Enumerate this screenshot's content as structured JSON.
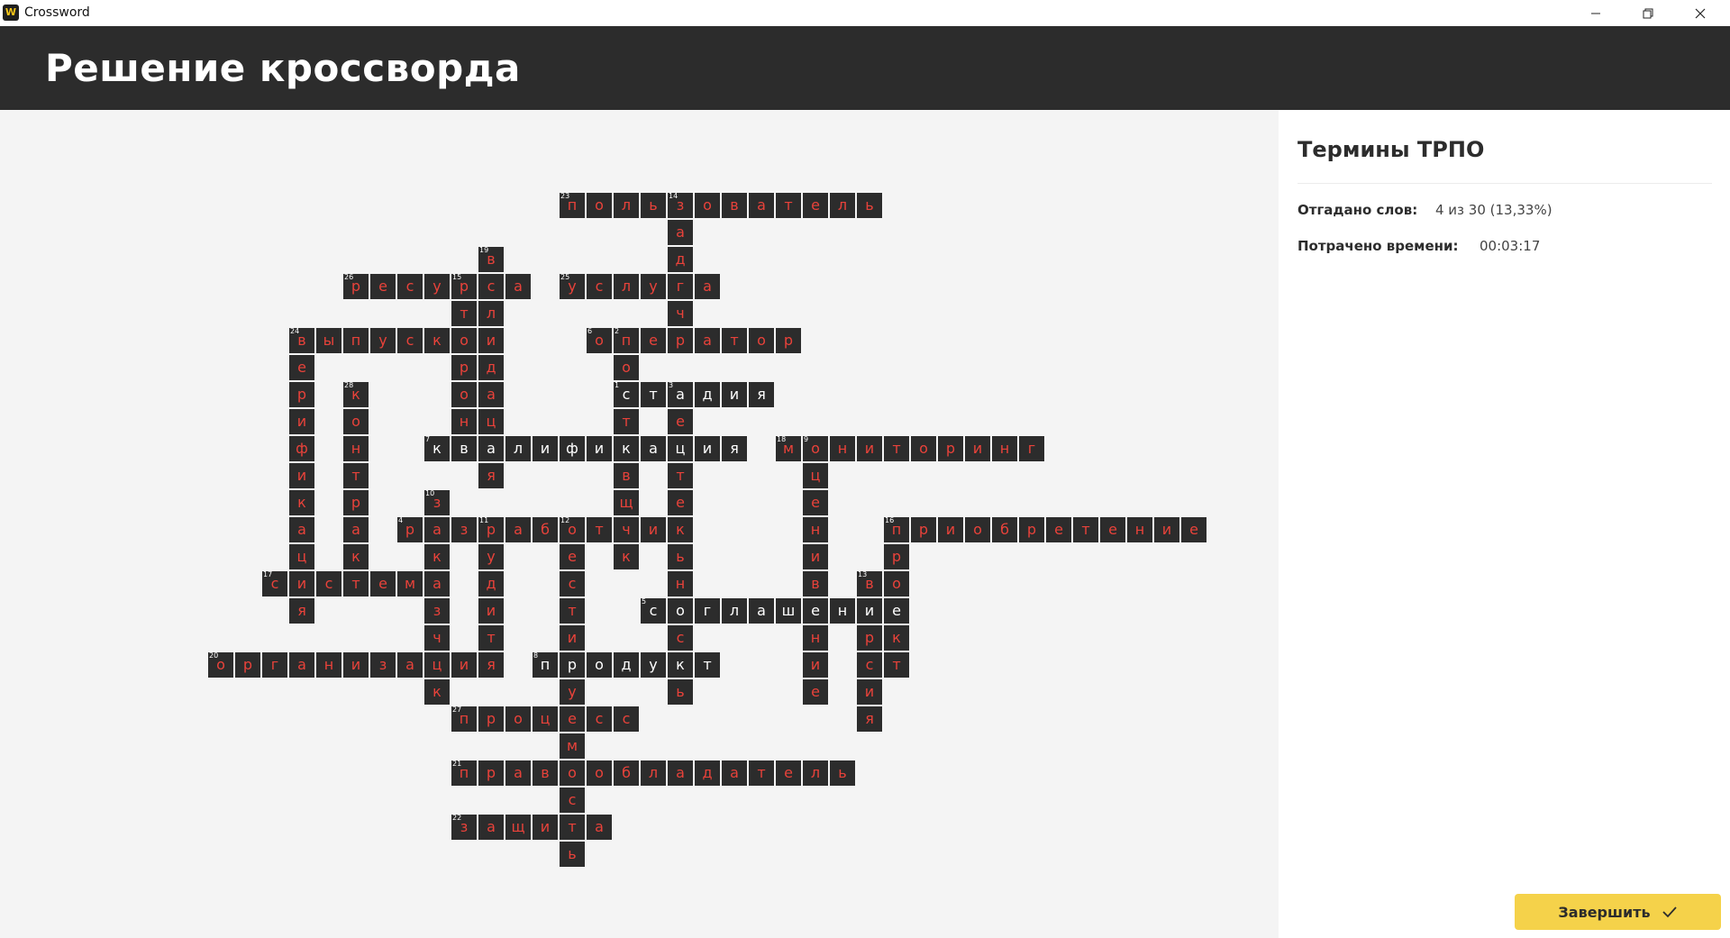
{
  "window": {
    "title": "Crossword",
    "app_icon": "crossword-app-icon"
  },
  "header": {
    "title": "Решение кроссворда"
  },
  "sidebar": {
    "title": "Термины ТРПО",
    "solved_label": "Отгадано слов:",
    "solved_value": "4 из 30 (13,33%)",
    "time_label": "Потрачено времени:",
    "time_value": "00:03:17"
  },
  "finish_button": {
    "label": "Завершить",
    "icon": "check-icon"
  },
  "colors": {
    "header_bg": "#2c2c2c",
    "cell_bg": "#2c2c2c",
    "letter_wrong": "#e8423a",
    "letter_correct": "#ffffff",
    "accent": "#f5d24a"
  },
  "grid": [
    [
      "",
      "",
      "",
      "",
      "",
      "",
      "",
      "",
      "",
      "",
      "",
      "",
      "",
      "",
      "",
      "",
      "",
      "",
      "",
      "",
      "",
      "",
      "",
      "",
      "",
      "",
      "",
      "",
      "",
      "",
      "",
      "",
      "",
      "",
      "",
      "",
      "",
      "",
      "",
      "",
      "",
      ""
    ],
    [
      "",
      "",
      "",
      "",
      "",
      "",
      "",
      "",
      "",
      "",
      "",
      "",
      "",
      "",
      "",
      "",
      "",
      "п",
      "о",
      "л",
      "ь",
      "з",
      "о",
      "в",
      "а",
      "т",
      "е",
      "л",
      "ь",
      "",
      "",
      "",
      "",
      "",
      "",
      "",
      "",
      "",
      "",
      "",
      "",
      ""
    ],
    [
      "",
      "",
      "",
      "",
      "",
      "",
      "",
      "",
      "",
      "",
      "",
      "",
      "",
      "",
      "",
      "",
      "",
      "",
      "",
      "",
      "",
      "а",
      "",
      "",
      "",
      "",
      "",
      "",
      "",
      "",
      "",
      "",
      "",
      "",
      "",
      "",
      "",
      "",
      "",
      "",
      "",
      ""
    ],
    [
      "",
      "",
      "",
      "",
      "",
      "",
      "",
      "",
      "",
      "",
      "",
      "",
      "",
      "",
      "в",
      "",
      "",
      "",
      "",
      "",
      "",
      "д",
      "",
      "",
      "",
      "",
      "",
      "",
      "",
      "",
      "",
      "",
      "",
      "",
      "",
      "",
      "",
      "",
      "",
      "",
      "",
      ""
    ],
    [
      "",
      "",
      "",
      "",
      "",
      "",
      "",
      "",
      "",
      "р",
      "е",
      "с",
      "у",
      "р",
      "с",
      "а",
      "",
      "у",
      "с",
      "л",
      "у",
      "г",
      "а",
      "",
      "",
      "",
      "",
      "",
      "",
      "",
      "",
      "",
      "",
      "",
      "",
      "",
      "",
      "",
      "",
      "",
      "",
      ""
    ],
    [
      "",
      "",
      "",
      "",
      "",
      "",
      "",
      "",
      "",
      "",
      "",
      "",
      "",
      "т",
      "л",
      "",
      "",
      "",
      "",
      "",
      "",
      "ч",
      "",
      "",
      "",
      "",
      "",
      "",
      "",
      "",
      "",
      "",
      "",
      "",
      "",
      "",
      "",
      "",
      "",
      "",
      "",
      ""
    ],
    [
      "",
      "",
      "",
      "",
      "",
      "",
      "",
      "в",
      "ы",
      "п",
      "у",
      "с",
      "к",
      "о",
      "и",
      "",
      "",
      "",
      "о",
      "п",
      "е",
      "р",
      "а",
      "т",
      "о",
      "р",
      "",
      "",
      "",
      "",
      "",
      "",
      "",
      "",
      "",
      "",
      "",
      "",
      "",
      "",
      "",
      ""
    ],
    [
      "",
      "",
      "",
      "",
      "",
      "",
      "",
      "е",
      "",
      "",
      "",
      "",
      "",
      "р",
      "д",
      "",
      "",
      "",
      "",
      "о",
      "",
      "",
      "",
      "",
      "",
      "",
      "",
      "",
      "",
      "",
      "",
      "",
      "",
      "",
      "",
      "",
      "",
      "",
      "",
      "",
      "",
      ""
    ],
    [
      "",
      "",
      "",
      "",
      "",
      "",
      "",
      "р",
      "",
      "к",
      "",
      "",
      "",
      "о",
      "а",
      "",
      "",
      "",
      "",
      "с",
      "т",
      "а",
      "д",
      "и",
      "я",
      "",
      "",
      "",
      "",
      "",
      "",
      "",
      "",
      "",
      "",
      "",
      "",
      "",
      "",
      "",
      "",
      ""
    ],
    [
      "",
      "",
      "",
      "",
      "",
      "",
      "",
      "и",
      "",
      "о",
      "",
      "",
      "",
      "н",
      "ц",
      "",
      "",
      "",
      "",
      "т",
      "",
      "е",
      "",
      "",
      "",
      "",
      "",
      "",
      "",
      "",
      "",
      "",
      "",
      "",
      "",
      "",
      "",
      "",
      "",
      "",
      "",
      ""
    ],
    [
      "",
      "",
      "",
      "",
      "",
      "",
      "",
      "ф",
      "",
      "н",
      "",
      "",
      "к",
      "в",
      "а",
      "л",
      "и",
      "ф",
      "и",
      "к",
      "а",
      "ц",
      "и",
      "я",
      "",
      "м",
      "о",
      "н",
      "и",
      "т",
      "о",
      "р",
      "и",
      "н",
      "г",
      "",
      "",
      "",
      "",
      "",
      "",
      ""
    ],
    [
      "",
      "",
      "",
      "",
      "",
      "",
      "",
      "и",
      "",
      "т",
      "",
      "",
      "",
      "",
      "я",
      "",
      "",
      "",
      "",
      "в",
      "",
      "т",
      "",
      "",
      "",
      "",
      "ц",
      "",
      "",
      "",
      "",
      "",
      "",
      "",
      "",
      "",
      "",
      "",
      "",
      "",
      "",
      ""
    ],
    [
      "",
      "",
      "",
      "",
      "",
      "",
      "",
      "к",
      "",
      "р",
      "",
      "",
      "з",
      "",
      "",
      "",
      "",
      "",
      "",
      "щ",
      "",
      "е",
      "",
      "",
      "",
      "",
      "е",
      "",
      "",
      "",
      "",
      "",
      "",
      "",
      "",
      "",
      "",
      "",
      "",
      "",
      "",
      ""
    ],
    [
      "",
      "",
      "",
      "",
      "",
      "",
      "",
      "а",
      "",
      "а",
      "",
      "р",
      "а",
      "з",
      "р",
      "а",
      "б",
      "о",
      "т",
      "ч",
      "и",
      "к",
      "",
      "",
      "",
      "",
      "н",
      "",
      "",
      "п",
      "р",
      "и",
      "о",
      "б",
      "р",
      "е",
      "т",
      "е",
      "н",
      "и",
      "е",
      ""
    ],
    [
      "",
      "",
      "",
      "",
      "",
      "",
      "",
      "ц",
      "",
      "к",
      "",
      "",
      "к",
      "",
      "у",
      "",
      "",
      "е",
      "",
      "к",
      "",
      "ь",
      "",
      "",
      "",
      "",
      "и",
      "",
      "",
      "р",
      "",
      "",
      "",
      "",
      "",
      "",
      "",
      "",
      "",
      "",
      "",
      ""
    ],
    [
      "",
      "",
      "",
      "",
      "",
      "",
      "с",
      "и",
      "с",
      "т",
      "е",
      "м",
      "а",
      "",
      "д",
      "",
      "",
      "с",
      "",
      "",
      "",
      "н",
      "",
      "",
      "",
      "",
      "в",
      "",
      "в",
      "о",
      "",
      "",
      "",
      "",
      "",
      "",
      "",
      "",
      "",
      "",
      "",
      ""
    ],
    [
      "",
      "",
      "",
      "",
      "",
      "",
      "",
      "я",
      "",
      "",
      "",
      "",
      "з",
      "",
      "и",
      "",
      "",
      "т",
      "",
      "",
      "с",
      "о",
      "г",
      "л",
      "а",
      "ш",
      "е",
      "н",
      "и",
      "е",
      "",
      "",
      "",
      "",
      "",
      "",
      "",
      "",
      "",
      "",
      "",
      ""
    ],
    [
      "",
      "",
      "",
      "",
      "",
      "",
      "",
      "",
      "",
      "",
      "",
      "",
      "ч",
      "",
      "т",
      "",
      "",
      "и",
      "",
      "",
      "",
      "с",
      "",
      "",
      "",
      "",
      "н",
      "",
      "р",
      "к",
      "",
      "",
      "",
      "",
      "",
      "",
      "",
      "",
      "",
      "",
      "",
      ""
    ],
    [
      "",
      "",
      "",
      "",
      "о",
      "р",
      "г",
      "а",
      "н",
      "и",
      "з",
      "а",
      "ц",
      "и",
      "я",
      "",
      "п",
      "р",
      "о",
      "д",
      "у",
      "к",
      "т",
      "",
      "",
      "",
      "и",
      "",
      "с",
      "т",
      "",
      "",
      "",
      "",
      "",
      "",
      "",
      "",
      "",
      "",
      "",
      ""
    ],
    [
      "",
      "",
      "",
      "",
      "",
      "",
      "",
      "",
      "",
      "",
      "",
      "",
      "к",
      "",
      "",
      "",
      "",
      "у",
      "",
      "",
      "",
      "ь",
      "",
      "",
      "",
      "",
      "е",
      "",
      "и",
      "",
      "",
      "",
      "",
      "",
      "",
      "",
      "",
      "",
      "",
      "",
      "",
      ""
    ],
    [
      "",
      "",
      "",
      "",
      "",
      "",
      "",
      "",
      "",
      "",
      "",
      "",
      "",
      "п",
      "р",
      "о",
      "ц",
      "е",
      "с",
      "с",
      "",
      "",
      "",
      "",
      "",
      "",
      "",
      "",
      "я",
      "",
      "",
      "",
      "",
      "",
      "",
      "",
      "",
      "",
      "",
      "",
      "",
      ""
    ],
    [
      "",
      "",
      "",
      "",
      "",
      "",
      "",
      "",
      "",
      "",
      "",
      "",
      "",
      "",
      "",
      "",
      "",
      "м",
      "",
      "",
      "",
      "",
      "",
      "",
      "",
      "",
      "",
      "",
      "",
      "",
      "",
      "",
      "",
      "",
      "",
      "",
      "",
      "",
      "",
      "",
      "",
      ""
    ],
    [
      "",
      "",
      "",
      "",
      "",
      "",
      "",
      "",
      "",
      "",
      "",
      "",
      "",
      "п",
      "р",
      "а",
      "в",
      "о",
      "о",
      "б",
      "л",
      "а",
      "д",
      "а",
      "т",
      "е",
      "л",
      "ь",
      "",
      "",
      "",
      "",
      "",
      "",
      "",
      "",
      "",
      "",
      "",
      "",
      "",
      ""
    ],
    [
      "",
      "",
      "",
      "",
      "",
      "",
      "",
      "",
      "",
      "",
      "",
      "",
      "",
      "",
      "",
      "",
      "",
      "с",
      "",
      "",
      "",
      "",
      "",
      "",
      "",
      "",
      "",
      "",
      "",
      "",
      "",
      "",
      "",
      "",
      "",
      "",
      "",
      "",
      "",
      "",
      "",
      ""
    ],
    [
      "",
      "",
      "",
      "",
      "",
      "",
      "",
      "",
      "",
      "",
      "",
      "",
      "",
      "з",
      "а",
      "щ",
      "и",
      "т",
      "а",
      "",
      "",
      "",
      "",
      "",
      "",
      "",
      "",
      "",
      "",
      "",
      "",
      "",
      "",
      "",
      "",
      "",
      "",
      "",
      "",
      "",
      "",
      ""
    ],
    [
      "",
      "",
      "",
      "",
      "",
      "",
      "",
      "",
      "",
      "",
      "",
      "",
      "",
      "",
      "",
      "",
      "",
      "ь",
      "",
      "",
      "",
      "",
      "",
      "",
      "",
      "",
      "",
      "",
      "",
      "",
      "",
      "",
      "",
      "",
      "",
      "",
      "",
      "",
      "",
      "",
      "",
      ""
    ]
  ],
  "correct_words": [
    {
      "r": 8,
      "c": 19,
      "len": 6
    },
    {
      "r": 10,
      "c": 12,
      "len": 12
    },
    {
      "r": 16,
      "c": 20,
      "len": 10
    },
    {
      "r": 18,
      "c": 16,
      "len": 7
    }
  ],
  "numbers": [
    {
      "r": 1,
      "c": 17,
      "n": "23"
    },
    {
      "r": 1,
      "c": 21,
      "n": "14"
    },
    {
      "r": 3,
      "c": 14,
      "n": "19"
    },
    {
      "r": 4,
      "c": 9,
      "n": "26"
    },
    {
      "r": 4,
      "c": 13,
      "n": "15"
    },
    {
      "r": 4,
      "c": 17,
      "n": "25"
    },
    {
      "r": 6,
      "c": 7,
      "n": "24"
    },
    {
      "r": 6,
      "c": 18,
      "n": "6"
    },
    {
      "r": 6,
      "c": 19,
      "n": "2"
    },
    {
      "r": 8,
      "c": 9,
      "n": "28"
    },
    {
      "r": 8,
      "c": 19,
      "n": "1"
    },
    {
      "r": 8,
      "c": 21,
      "n": "3"
    },
    {
      "r": 10,
      "c": 12,
      "n": "7"
    },
    {
      "r": 10,
      "c": 25,
      "n": "18"
    },
    {
      "r": 10,
      "c": 26,
      "n": "9"
    },
    {
      "r": 12,
      "c": 12,
      "n": "10"
    },
    {
      "r": 13,
      "c": 11,
      "n": "4"
    },
    {
      "r": 13,
      "c": 14,
      "n": "11"
    },
    {
      "r": 13,
      "c": 17,
      "n": "12"
    },
    {
      "r": 13,
      "c": 29,
      "n": "16"
    },
    {
      "r": 15,
      "c": 6,
      "n": "17"
    },
    {
      "r": 15,
      "c": 28,
      "n": "13"
    },
    {
      "r": 16,
      "c": 20,
      "n": "5"
    },
    {
      "r": 18,
      "c": 4,
      "n": "20"
    },
    {
      "r": 18,
      "c": 16,
      "n": "8"
    },
    {
      "r": 20,
      "c": 13,
      "n": "27"
    },
    {
      "r": 22,
      "c": 13,
      "n": "21"
    },
    {
      "r": 24,
      "c": 13,
      "n": "22"
    }
  ]
}
